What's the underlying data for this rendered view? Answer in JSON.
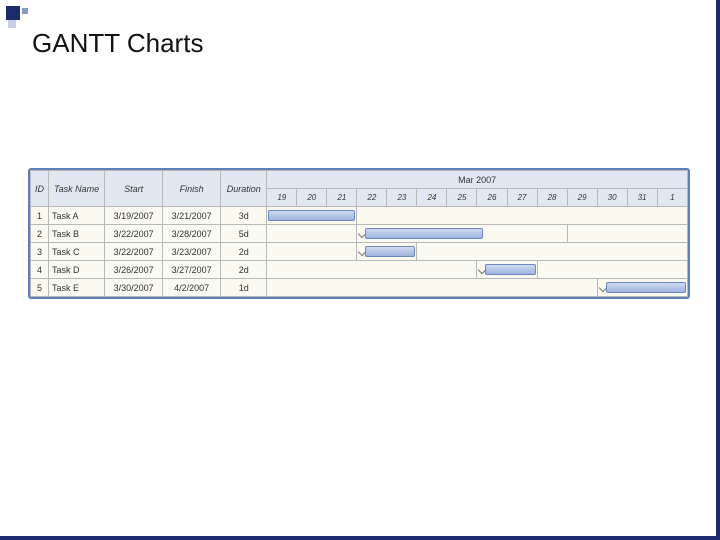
{
  "slide": {
    "title": "GANTT Charts"
  },
  "headers": {
    "id": "ID",
    "name": "Task Name",
    "start": "Start",
    "finish": "Finish",
    "duration": "Duration",
    "month": "Mar 2007"
  },
  "days": [
    "19",
    "20",
    "21",
    "22",
    "23",
    "24",
    "25",
    "26",
    "27",
    "28",
    "29",
    "30",
    "31",
    "1"
  ],
  "tasks": [
    {
      "id": "1",
      "name": "Task A",
      "start": "3/19/2007",
      "finish": "3/21/2007",
      "duration": "3d"
    },
    {
      "id": "2",
      "name": "Task B",
      "start": "3/22/2007",
      "finish": "3/28/2007",
      "duration": "5d"
    },
    {
      "id": "3",
      "name": "Task C",
      "start": "3/22/2007",
      "finish": "3/23/2007",
      "duration": "2d"
    },
    {
      "id": "4",
      "name": "Task D",
      "start": "3/26/2007",
      "finish": "3/27/2007",
      "duration": "2d"
    },
    {
      "id": "5",
      "name": "Task E",
      "start": "3/30/2007",
      "finish": "4/2/2007",
      "duration": "1d"
    }
  ],
  "chart_data": {
    "type": "bar",
    "title": "GANTT Charts",
    "xlabel": "Mar 2007",
    "ylabel": "Task",
    "categories": [
      "19",
      "20",
      "21",
      "22",
      "23",
      "24",
      "25",
      "26",
      "27",
      "28",
      "29",
      "30",
      "31",
      "1"
    ],
    "series": [
      {
        "name": "Task A",
        "start_day": 19,
        "end_day": 21,
        "duration_days": 3
      },
      {
        "name": "Task B",
        "start_day": 22,
        "end_day": 28,
        "duration_days": 5
      },
      {
        "name": "Task C",
        "start_day": 22,
        "end_day": 23,
        "duration_days": 2
      },
      {
        "name": "Task D",
        "start_day": 26,
        "end_day": 27,
        "duration_days": 2
      },
      {
        "name": "Task E",
        "start_day": 30,
        "end_day": 32,
        "duration_days": 1
      }
    ],
    "xlim": [
      19,
      32
    ]
  }
}
